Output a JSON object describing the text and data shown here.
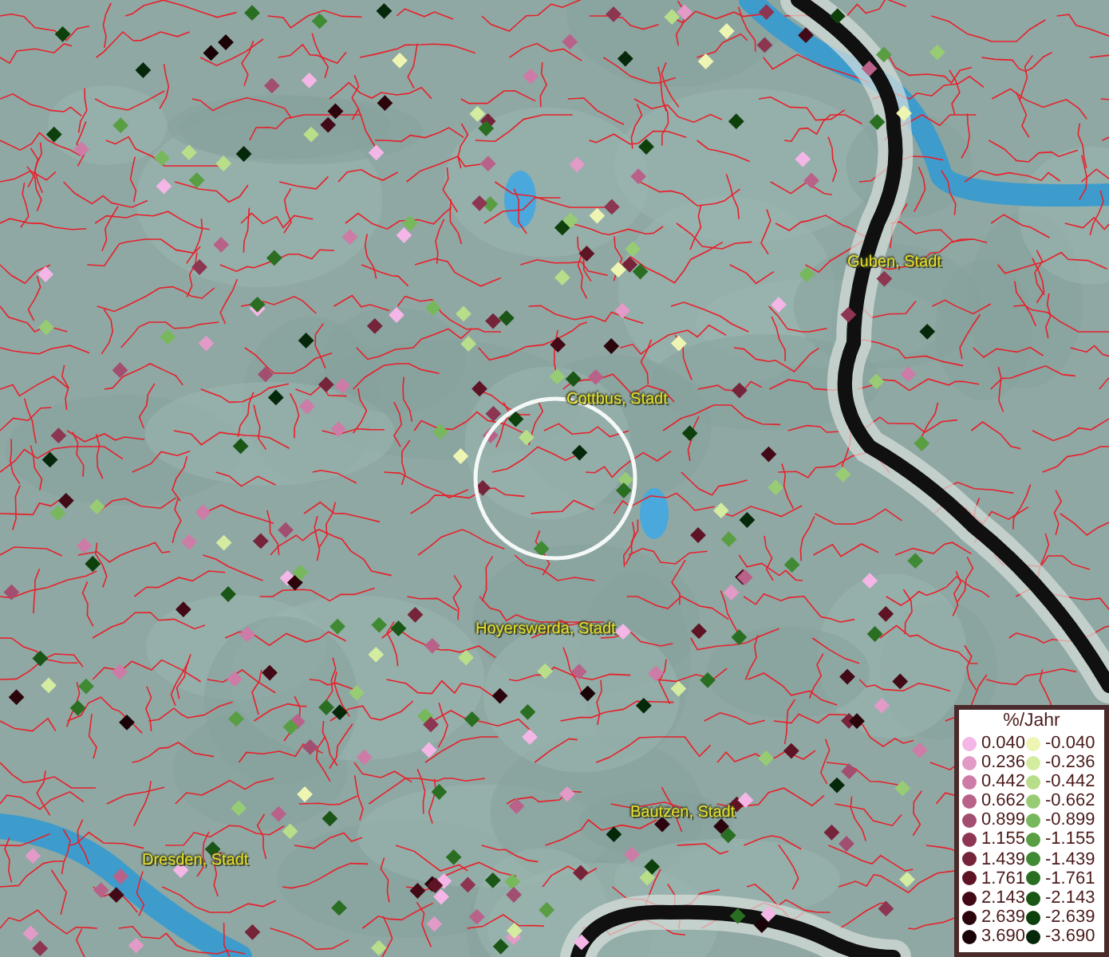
{
  "map": {
    "cities": [
      {
        "name": "Guben, Stadt"
      },
      {
        "name": "Cottbus, Stadt"
      },
      {
        "name": "Hoyerswerda, Stadt"
      },
      {
        "name": "Bautzen, Stadt"
      },
      {
        "name": "Dresden, Stadt"
      }
    ]
  },
  "legend": {
    "title": "%/Jahr",
    "positive": [
      {
        "label": "0.040",
        "color": "#f4b6e6"
      },
      {
        "label": "0.236",
        "color": "#e29ac6"
      },
      {
        "label": "0.442",
        "color": "#cc7ca6"
      },
      {
        "label": "0.662",
        "color": "#b8628a"
      },
      {
        "label": "0.899",
        "color": "#a24e70"
      },
      {
        "label": "1.155",
        "color": "#8c3652"
      },
      {
        "label": "1.439",
        "color": "#76243a"
      },
      {
        "label": "1.761",
        "color": "#5e1424"
      },
      {
        "label": "2.143",
        "color": "#420a16"
      },
      {
        "label": "2.639",
        "color": "#2c050c"
      },
      {
        "label": "3.690",
        "color": "#1a0306"
      }
    ],
    "negative": [
      {
        "label": "-0.040",
        "color": "#eef5b2"
      },
      {
        "label": "-0.236",
        "color": "#d4eca0"
      },
      {
        "label": "-0.442",
        "color": "#b8de8a"
      },
      {
        "label": "-0.662",
        "color": "#98cc74"
      },
      {
        "label": "-0.899",
        "color": "#78b85c"
      },
      {
        "label": "-1.155",
        "color": "#5a9e44"
      },
      {
        "label": "-1.439",
        "color": "#408a34"
      },
      {
        "label": "-1.761",
        "color": "#2a6e22"
      },
      {
        "label": "-2.143",
        "color": "#1a5616"
      },
      {
        "label": "-2.639",
        "color": "#0e400c"
      },
      {
        "label": "-3.690",
        "color": "#06280a"
      }
    ]
  }
}
